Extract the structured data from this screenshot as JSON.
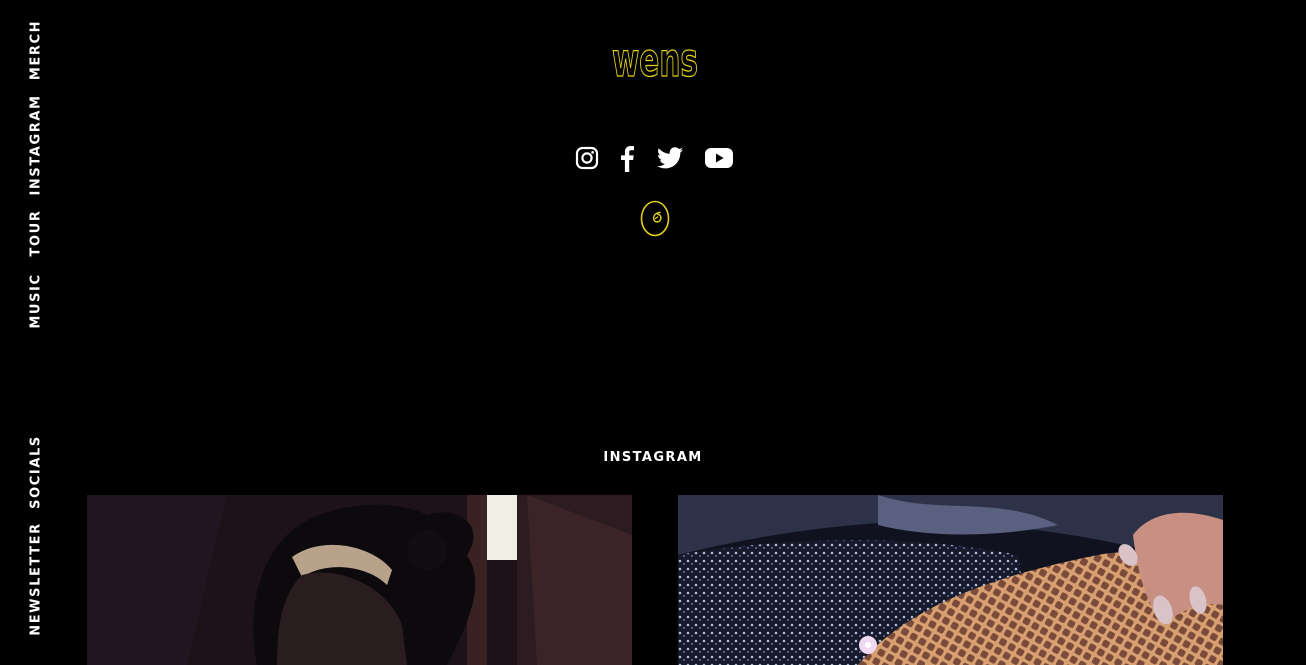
{
  "side_nav": {
    "items": [
      {
        "label": "MERCH"
      },
      {
        "label": "INSTAGRAM"
      },
      {
        "label": "TOUR"
      },
      {
        "label": "MUSIC"
      }
    ],
    "bottom_items": [
      {
        "label": "SOCIALS"
      },
      {
        "label": "NEWSLETTER"
      }
    ]
  },
  "header": {
    "logo_text": "wens"
  },
  "social_links": [
    {
      "icon": "instagram-icon"
    },
    {
      "icon": "facebook-icon"
    },
    {
      "icon": "twitter-icon"
    },
    {
      "icon": "youtube-icon"
    }
  ],
  "instagram": {
    "heading": "INSTAGRAM"
  },
  "colors": {
    "background": "#000000",
    "text": "#ffffff",
    "accent": "#e3d01a"
  }
}
